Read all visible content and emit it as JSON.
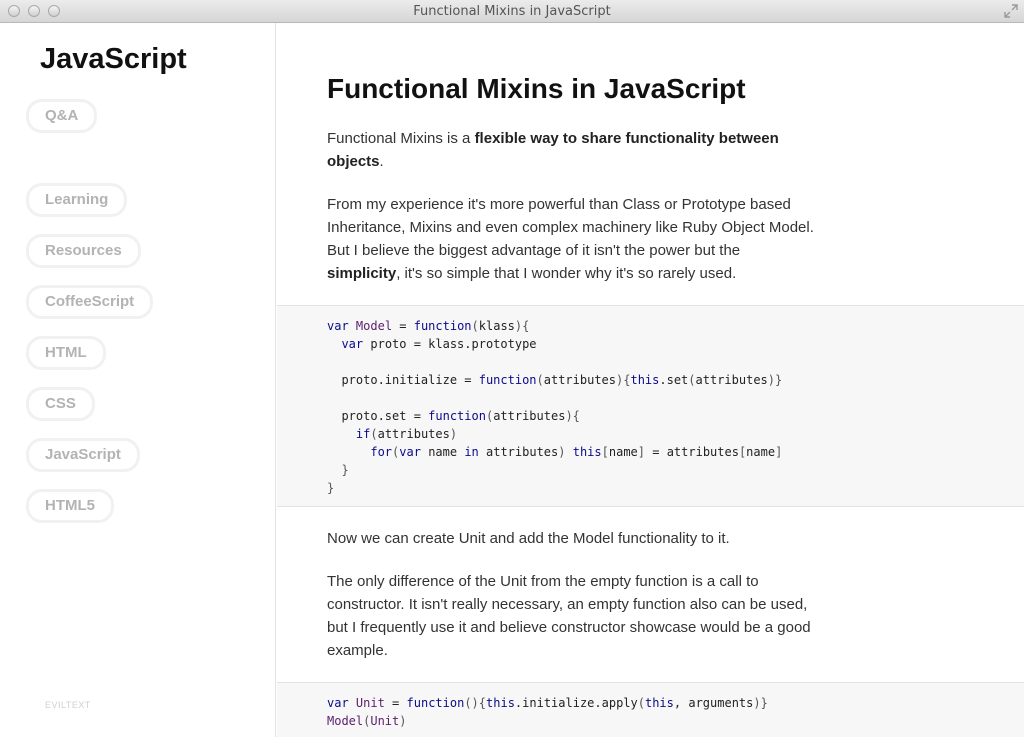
{
  "window": {
    "title": "Functional Mixins in JavaScript"
  },
  "sidebar": {
    "brand": "JavaScript",
    "items": [
      {
        "label": "Q&A"
      },
      {
        "label": "Learning"
      },
      {
        "label": "Resources"
      },
      {
        "label": "CoffeeScript"
      },
      {
        "label": "HTML"
      },
      {
        "label": "CSS"
      },
      {
        "label": "JavaScript"
      },
      {
        "label": "HTML5"
      }
    ],
    "footer": "EVILTEXT"
  },
  "article": {
    "title": "Functional Mixins in JavaScript",
    "p1": {
      "a": "Functional Mixins is a ",
      "b": "flexible way to share functionality between objects",
      "c": "."
    },
    "p2": {
      "a": "From my experience it's more powerful than Class or Prototype based Inheritance, Mixins and even complex machinery like Ruby Object Model. But I believe the biggest advantage of it isn't the power but the ",
      "b": "simplicity",
      "c": ", it's so simple that I wonder why it's so rarely used."
    },
    "p3": "Now we can create Unit and add the Model functionality to it.",
    "p4": "The only difference of the Unit from the empty function is a call to constructor. It isn't really necessary, an empty function also can be used, but I frequently use it and believe constructor showcase would be a good example.",
    "code1": [
      "var Model = function(klass){",
      "  var proto = klass.prototype",
      "",
      "  proto.initialize = function(attributes){this.set(attributes)}",
      "",
      "  proto.set = function(attributes){",
      "    if(attributes)",
      "      for(var name in attributes) this[name] = attributes[name]",
      "  }",
      "}"
    ],
    "code2": [
      "var Unit = function(){this.initialize.apply(this, arguments)}",
      "Model(Unit)"
    ]
  },
  "colors": {
    "keyword": "#0b0b8a",
    "function_name": "#5a1f6e",
    "punct": "#555555"
  }
}
